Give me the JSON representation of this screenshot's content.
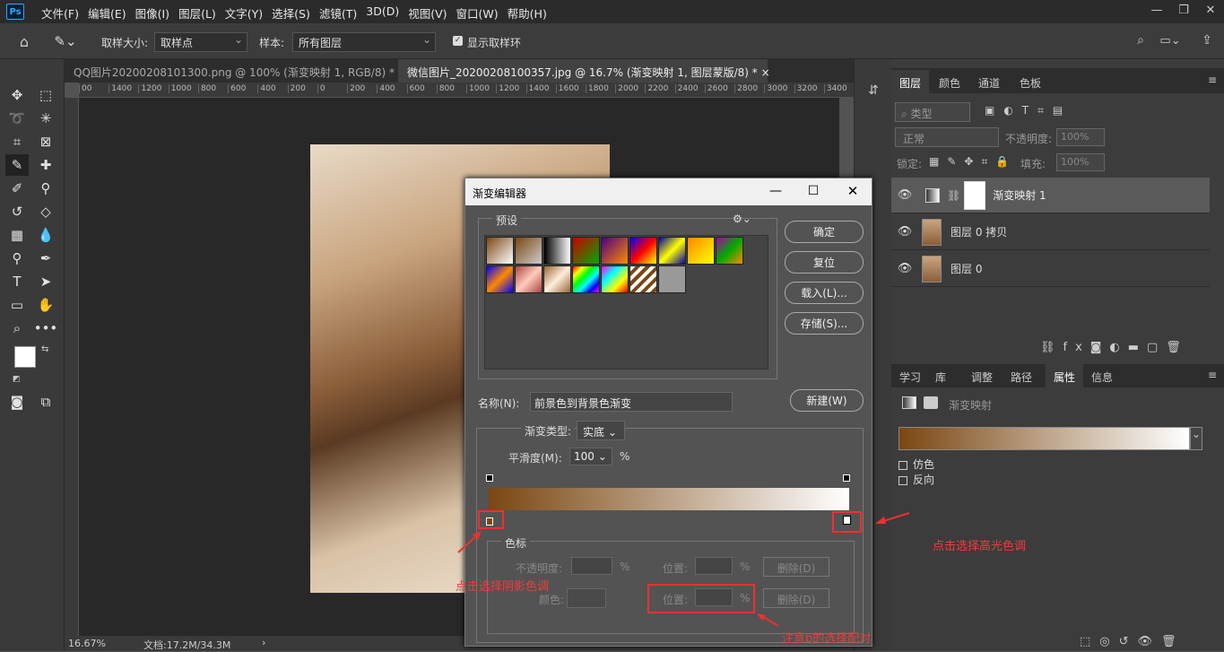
{
  "menubar": {
    "logo": "Ps",
    "items": [
      "文件(F)",
      "编辑(E)",
      "图像(I)",
      "图层(L)",
      "文字(Y)",
      "选择(S)",
      "滤镜(T)",
      "3D(D)",
      "视图(V)",
      "窗口(W)",
      "帮助(H)"
    ]
  },
  "options": {
    "sample_size_label": "取样大小:",
    "sample_size_value": "取样点",
    "sample_label": "样本:",
    "sample_value": "所有图层",
    "show_ring_label": "显示取样环"
  },
  "tabs": [
    {
      "label": "QQ图片20200208101300.png @ 100% (渐变映射 1, RGB/8) *",
      "close": "×"
    },
    {
      "label": "微信图片_20200208100357.jpg @ 16.7% (渐变映射 1, 图层蒙版/8) *",
      "close": "×"
    }
  ],
  "ruler": {
    "ticks": [
      "00",
      "1400",
      "1200",
      "1000",
      "800",
      "600",
      "400",
      "200",
      "0",
      "200",
      "400",
      "600",
      "800",
      "1000",
      "1200",
      "1400",
      "1600",
      "1800",
      "2000",
      "2200",
      "2400",
      "2600",
      "2800",
      "3000",
      "3200",
      "3400"
    ]
  },
  "status": {
    "zoom": "16.67%",
    "doc": "文档:17.2M/34.3M",
    "arrow": "›"
  },
  "layers_panel": {
    "tabs": [
      "图层",
      "颜色",
      "通道",
      "色板"
    ],
    "kind_placeholder": "类型",
    "blend_mode": "正常",
    "opacity_label": "不透明度:",
    "opacity_value": "100%",
    "lock_label": "锁定:",
    "fill_label": "填充:",
    "fill_value": "100%",
    "layers": [
      {
        "name": "渐变映射 1"
      },
      {
        "name": "图层 0 拷贝"
      },
      {
        "name": "图层 0"
      }
    ]
  },
  "props_panel": {
    "tabs": [
      "学习",
      "库",
      "调整",
      "路径",
      "属性",
      "信息"
    ],
    "title": "渐变映射",
    "dither_label": "仿色",
    "reverse_label": "反向"
  },
  "dialog": {
    "title": "渐变编辑器",
    "presets_label": "预设",
    "buttons": {
      "ok": "确定",
      "reset": "复位",
      "load": "载入(L)...",
      "save": "存储(S)...",
      "new": "新建(W)"
    },
    "name_label": "名称(N):",
    "name_value": "前景色到背景色渐变",
    "type_label": "渐变类型:",
    "type_value": "实底",
    "smooth_label": "平滑度(M):",
    "smooth_value": "100",
    "percent": "%",
    "stops_label": "色标",
    "opacity_label": "不透明度:",
    "location_label": "位置:",
    "location2_label": "位置:",
    "delete_label": "删除(D)",
    "delete2_label": "删除(D)",
    "color_label": "颜色:"
  },
  "annotations": {
    "shadow": "点击选择阴影色调",
    "highlight": "点击选择高光色调",
    "note": "注意b的选择配对"
  },
  "colors": {
    "gradient_start": "#7a4712",
    "gradient_end": "#ffffff",
    "annotation": "#f03c3c"
  }
}
